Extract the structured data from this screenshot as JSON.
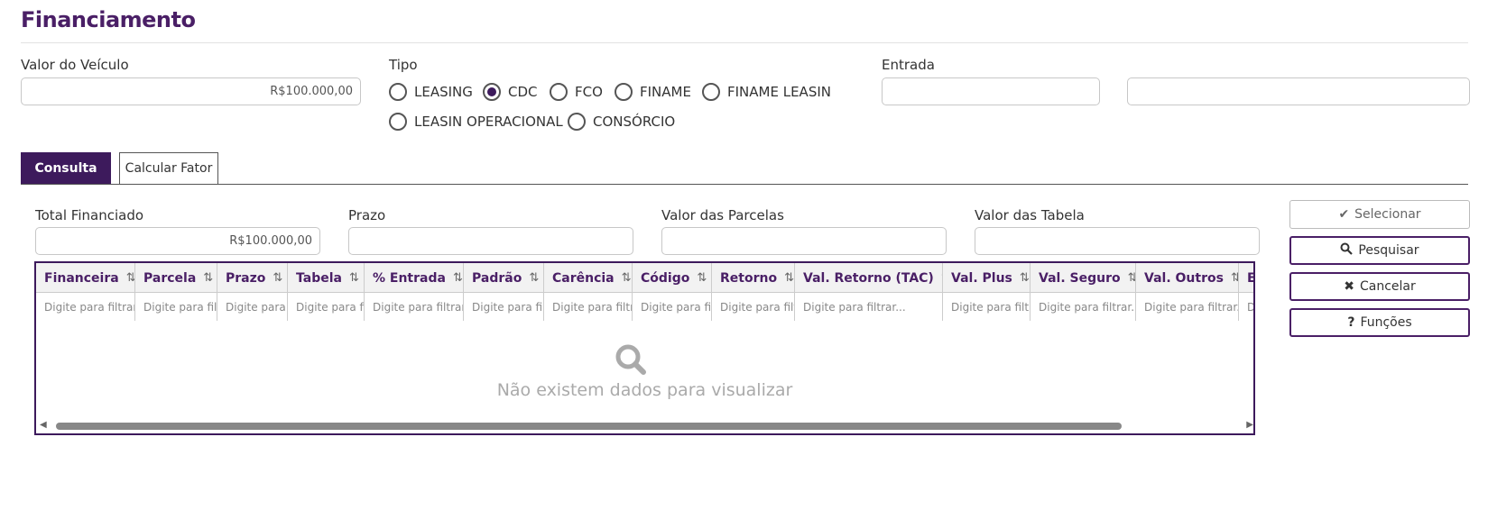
{
  "page": {
    "title": "Financiamento"
  },
  "form": {
    "valor_veiculo": {
      "label": "Valor do Veículo",
      "value": "R$100.000,00"
    },
    "tipo": {
      "label": "Tipo",
      "options": [
        "LEASING",
        "CDC",
        "FCO",
        "FINAME",
        "FINAME LEASIN",
        "LEASIN OPERACIONAL",
        "CONSÓRCIO"
      ],
      "selected": "CDC"
    },
    "entrada": {
      "label": "Entrada",
      "value1": "",
      "value2": ""
    }
  },
  "tabs": [
    {
      "label": "Consulta",
      "active": true
    },
    {
      "label": "Calcular Fator",
      "active": false
    }
  ],
  "consulta": {
    "total_financiado": {
      "label": "Total Financiado",
      "value": "R$100.000,00"
    },
    "prazo": {
      "label": "Prazo",
      "value": ""
    },
    "valor_parcelas": {
      "label": "Valor das Parcelas",
      "value": ""
    },
    "valor_tabela": {
      "label": "Valor das Tabela",
      "value": ""
    }
  },
  "actions": [
    {
      "label": "Selecionar",
      "icon": "check-icon",
      "enabled": false
    },
    {
      "label": "Pesquisar",
      "icon": "search-icon",
      "enabled": true
    },
    {
      "label": "Cancelar",
      "icon": "close-icon",
      "enabled": true
    },
    {
      "label": "Funções",
      "icon": "question-icon",
      "enabled": true
    }
  ],
  "grid": {
    "columns": [
      {
        "label": "Financeira",
        "filter": "Digite para filtrar..."
      },
      {
        "label": "Parcela",
        "filter": "Digite para filtrar..."
      },
      {
        "label": "Prazo",
        "filter": "Digite para filtrar..."
      },
      {
        "label": "Tabela",
        "filter": "Digite para filtrar..."
      },
      {
        "label": "% Entrada",
        "filter": "Digite para filtrar..."
      },
      {
        "label": "Padrão",
        "filter": "Digite para filtrar..."
      },
      {
        "label": "Carência",
        "filter": "Digite para filtrar..."
      },
      {
        "label": "Código",
        "filter": "Digite para filtrar..."
      },
      {
        "label": "Retorno",
        "filter": "Digite para filtrar..."
      },
      {
        "label": "Val. Retorno (TAC)",
        "filter": "Digite para filtrar..."
      },
      {
        "label": "Val. Plus",
        "filter": "Digite para filtrar..."
      },
      {
        "label": "Val. Seguro",
        "filter": "Digite para filtrar..."
      },
      {
        "label": "Val. Outros",
        "filter": "Digite para filtrar..."
      },
      {
        "label": "E",
        "filter": "Digite para filtrar..."
      }
    ],
    "sort_symbol": "⇅",
    "empty_message": "Não existem dados para visualizar"
  },
  "colors": {
    "accent": "#3d1a5c",
    "title": "#4a1f66"
  }
}
